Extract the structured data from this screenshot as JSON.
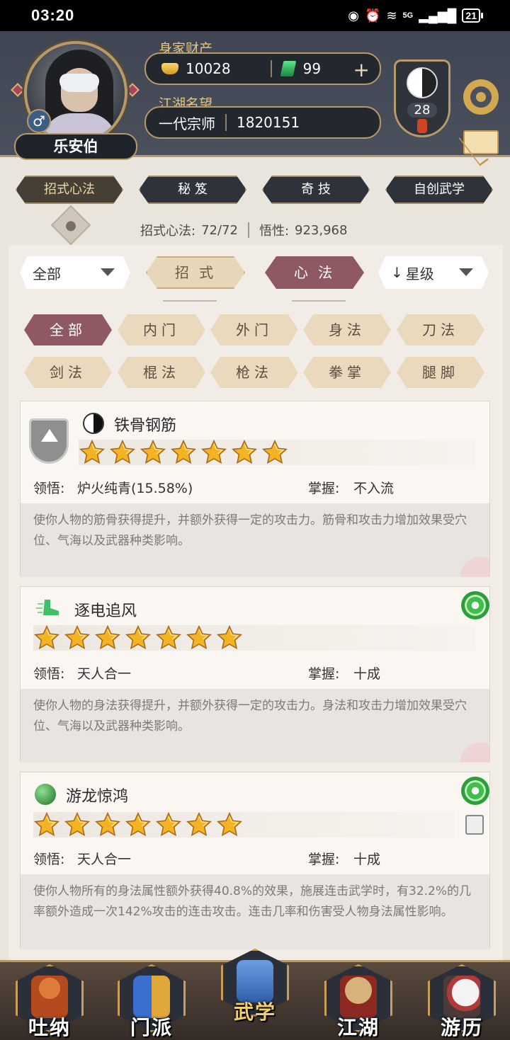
{
  "status_bar": {
    "time": "03:20",
    "network": "5G",
    "battery": "21"
  },
  "profile": {
    "name": "乐安伯",
    "gender_symbol": "♂",
    "wealth_label": "身家财产",
    "gold": "10028",
    "jade": "99",
    "fame_label": "江湖名望",
    "rank_title": "一代宗师",
    "fame_value": "1820151",
    "level": "28"
  },
  "main_tabs": [
    "招式心法",
    "秘 笈",
    "奇 技",
    "自创武学"
  ],
  "stats": {
    "moves_label": "招式心法:",
    "moves_value": "72/72",
    "insight_label": "悟性:",
    "insight_value": "923,968"
  },
  "filters": {
    "scope": "全部",
    "seg_moves": "招 式",
    "seg_heart": "心 法",
    "sort": "星级",
    "sort_arrow": "↓"
  },
  "categories": [
    "全部",
    "内门",
    "外门",
    "身法",
    "刀法",
    "剑法",
    "棍法",
    "枪法",
    "拳掌",
    "腿脚"
  ],
  "cards": [
    {
      "name": "铁骨钢筋",
      "stars": 7,
      "comprehension_label": "领悟:",
      "comprehension": "炉火纯青(15.58%)",
      "mastery_label": "掌握:",
      "mastery": "不入流",
      "description": "使你人物的筋骨获得提升，并额外获得一定的攻击力。筋骨和攻击力增加效果受穴位、气海以及武器种类影响。"
    },
    {
      "name": "逐电追风",
      "stars": 7,
      "comprehension_label": "领悟:",
      "comprehension": "天人合一",
      "mastery_label": "掌握:",
      "mastery": "十成",
      "description": "使你人物的身法获得提升，并额外获得一定的攻击力。身法和攻击力增加效果受穴位、气海以及武器种类影响。"
    },
    {
      "name": "游龙惊鸿",
      "stars": 7,
      "comprehension_label": "领悟:",
      "comprehension": "天人合一",
      "mastery_label": "掌握:",
      "mastery": "十成",
      "description": "使你人物所有的身法属性额外获得40.8%的效果，施展连击武学时，有32.2%的几率额外造成一次142%攻击的连击攻击。连击几率和伤害受人物身法属性影响。"
    }
  ],
  "bottom_nav": [
    "吐纳",
    "门派",
    "武学",
    "江湖",
    "游历"
  ],
  "colors": {
    "accent": "#8f5963",
    "gold_border": "#b79a6a",
    "header_bg": "#4a505c"
  }
}
